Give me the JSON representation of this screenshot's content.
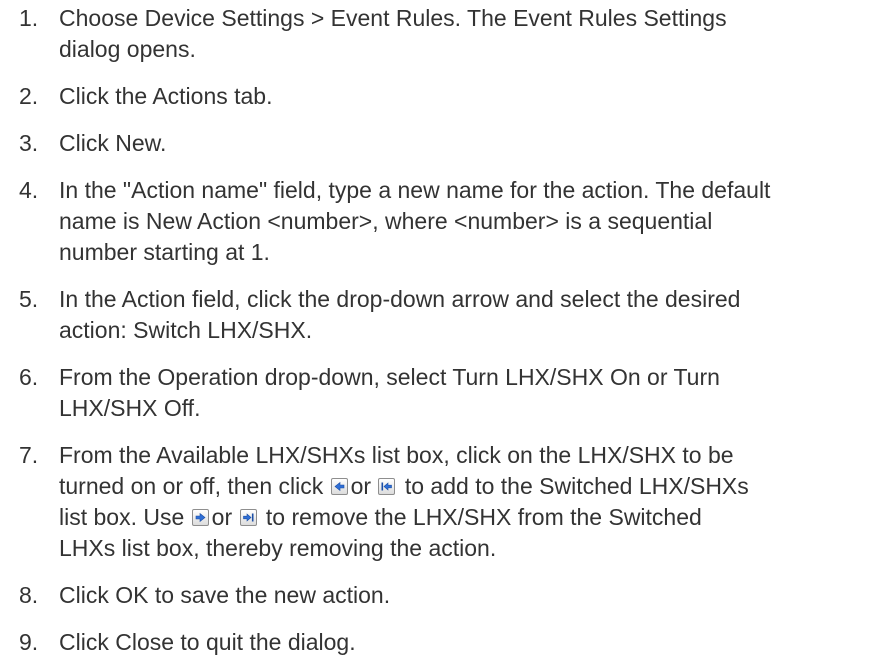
{
  "steps": [
    {
      "number": "1.",
      "lines": [
        "Choose Device Settings > Event Rules. The Event Rules Settings",
        "dialog opens."
      ]
    },
    {
      "number": "2.",
      "lines": [
        "Click the Actions tab."
      ]
    },
    {
      "number": "3.",
      "lines": [
        "Click New."
      ]
    },
    {
      "number": "4.",
      "lines": [
        "In the \"Action name\" field, type a new name for the action. The default",
        "name is New Action <number>, where <number> is a sequential",
        "number starting at 1."
      ]
    },
    {
      "number": "5.",
      "lines": [
        "In the Action field, click the drop-down arrow and select the desired",
        "action: Switch LHX/SHX."
      ]
    },
    {
      "number": "6.",
      "lines": [
        "From the Operation drop-down, select Turn LHX/SHX On or Turn",
        "LHX/SHX Off."
      ]
    },
    {
      "number": "7.",
      "line1": "From the Available LHX/SHXs list box, click on the LHX/SHX to be",
      "line2_a": "turned on or off, then click",
      "line2_b": "or",
      "line2_c": "to add to the Switched LHX/SHXs",
      "line3_a": "list box. Use",
      "line3_b": "or",
      "line3_c": "to remove the LHX/SHX from the Switched",
      "line4": "LHXs list box, thereby removing the action."
    },
    {
      "number": "8.",
      "lines": [
        "Click OK to save the new action."
      ]
    },
    {
      "number": "9.",
      "lines": [
        "Click Close to quit the dialog."
      ]
    }
  ],
  "icons": {
    "add": "arrow-left-icon",
    "add_all": "arrow-left-to-bar-icon",
    "remove": "arrow-right-icon",
    "remove_all": "arrow-right-to-bar-icon"
  },
  "colors": {
    "text": "#333333",
    "icon_arrow": "#2f6fd6"
  }
}
